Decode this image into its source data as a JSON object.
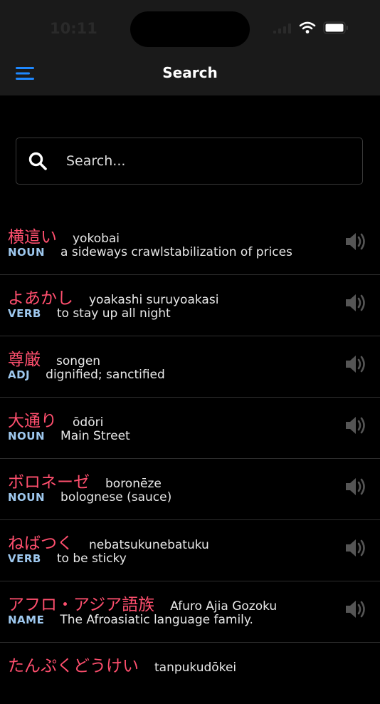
{
  "status_bar": {
    "time": "10:11"
  },
  "nav": {
    "title": "Search",
    "menu_icon": "hamburger-menu-icon"
  },
  "search": {
    "placeholder": "Search...",
    "value": "",
    "icon": "search-icon"
  },
  "entries": [
    {
      "word": "横這い",
      "reading": "yokobai",
      "pos": "NOUN",
      "meaning": "a sideways crawlstabilization of prices"
    },
    {
      "word": "よあかし",
      "reading": "yoakashi suruyoakasi",
      "pos": "VERB",
      "meaning": "to stay up all night"
    },
    {
      "word": "尊厳",
      "reading": "songen",
      "pos": "ADJ",
      "meaning": "dignified; sanctified"
    },
    {
      "word": "大通り",
      "reading": "ōdōri",
      "pos": "NOUN",
      "meaning": "Main Street"
    },
    {
      "word": "ボロネーゼ",
      "reading": "boronēze",
      "pos": "NOUN",
      "meaning": "bolognese (sauce)"
    },
    {
      "word": "ねばつく",
      "reading": "nebatsukunebatuku",
      "pos": "VERB",
      "meaning": "to be sticky"
    },
    {
      "word": "アフロ・アジア語族",
      "reading": "Afuro Ajia Gozoku",
      "pos": "NAME",
      "meaning": "The Afroasiatic language family."
    },
    {
      "word": "たんぷくどうけい",
      "reading": "tanpukudōkei",
      "pos": "",
      "meaning": ""
    }
  ],
  "colors": {
    "background": "#000000",
    "bar": "#1a1a1a",
    "word": "#ff4f6e",
    "pos": "#9ec8ee",
    "accent": "#1e88ff",
    "speaker": "#555555"
  }
}
